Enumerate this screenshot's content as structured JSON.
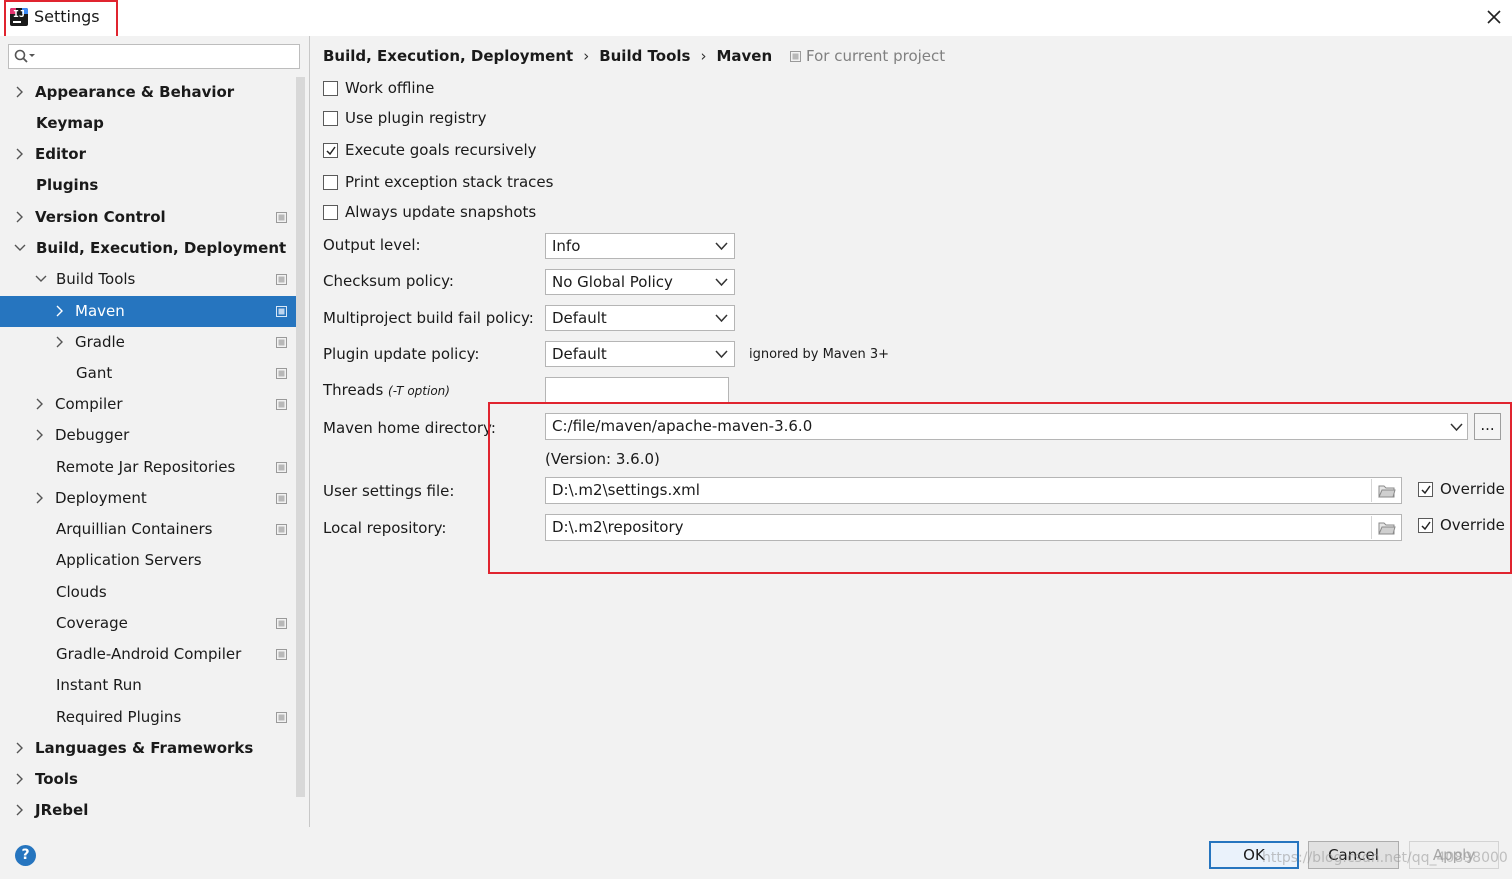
{
  "window": {
    "title": "Settings"
  },
  "search": {
    "placeholder": ""
  },
  "sidebar": {
    "items": [
      {
        "label": "Appearance & Behavior"
      },
      {
        "label": "Keymap"
      },
      {
        "label": "Editor"
      },
      {
        "label": "Plugins"
      },
      {
        "label": "Version Control"
      },
      {
        "label": "Build, Execution, Deployment"
      },
      {
        "label": "Build Tools"
      },
      {
        "label": "Maven"
      },
      {
        "label": "Gradle"
      },
      {
        "label": "Gant"
      },
      {
        "label": "Compiler"
      },
      {
        "label": "Debugger"
      },
      {
        "label": "Remote Jar Repositories"
      },
      {
        "label": "Deployment"
      },
      {
        "label": "Arquillian Containers"
      },
      {
        "label": "Application Servers"
      },
      {
        "label": "Clouds"
      },
      {
        "label": "Coverage"
      },
      {
        "label": "Gradle-Android Compiler"
      },
      {
        "label": "Instant Run"
      },
      {
        "label": "Required Plugins"
      },
      {
        "label": "Languages & Frameworks"
      },
      {
        "label": "Tools"
      },
      {
        "label": "JRebel"
      }
    ]
  },
  "breadcrumb": {
    "items": [
      "Build, Execution, Deployment",
      "Build Tools",
      "Maven"
    ],
    "separator": "›",
    "scope_note": "For current project"
  },
  "options": {
    "work_offline": {
      "label": "Work offline",
      "checked": false
    },
    "use_plugin_registry": {
      "label": "Use plugin registry",
      "checked": false
    },
    "execute_goals_recursively": {
      "label": "Execute goals recursively",
      "checked": true
    },
    "print_exception_stack_traces": {
      "label": "Print exception stack traces",
      "checked": false
    },
    "always_update_snapshots": {
      "label": "Always update snapshots",
      "checked": false
    }
  },
  "fields": {
    "output_level": {
      "label": "Output level:",
      "value": "Info"
    },
    "checksum_policy": {
      "label": "Checksum policy:",
      "value": "No Global Policy"
    },
    "multiproject_fail_policy": {
      "label": "Multiproject build fail policy:",
      "value": "Default"
    },
    "plugin_update_policy": {
      "label": "Plugin update policy:",
      "value": "Default",
      "note": "ignored by Maven 3+"
    },
    "threads": {
      "label": "Threads",
      "hint": "(-T option)",
      "value": ""
    },
    "maven_home": {
      "label": "Maven home directory:",
      "value": "C:/file/maven/apache-maven-3.6.0",
      "version": "(Version: 3.6.0)",
      "browse_label": "..."
    },
    "user_settings": {
      "label": "User settings file:",
      "value": "D:\\.m2\\settings.xml",
      "override_label": "Override",
      "override_checked": true
    },
    "local_repository": {
      "label": "Local repository:",
      "value": "D:\\.m2\\repository",
      "override_label": "Override",
      "override_checked": true
    }
  },
  "footer": {
    "help_label": "?",
    "ok_label": "OK",
    "cancel_label": "Cancel",
    "apply_label": "Apply",
    "watermark": "https://blog.csdn.net/qq_40898000"
  },
  "colors": {
    "selection": "#2675bf",
    "highlight_border": "#e0242f",
    "background": "#f2f2f2"
  }
}
